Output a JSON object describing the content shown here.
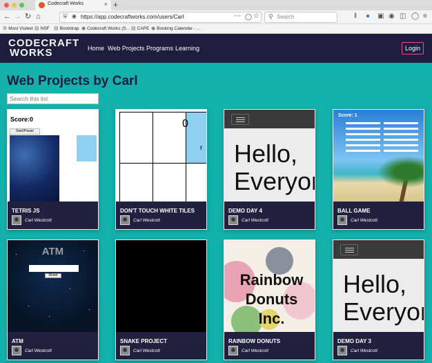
{
  "browser": {
    "tab_title": "Codecraft Works",
    "url": "https://app.codecraftworks.com/users/Carl",
    "search_placeholder": "Search",
    "bookmarks": [
      "Most Visited",
      "NSF",
      "Bootstrap",
      "Codecraft Works (S...",
      "CAPE",
      "Booking Calendar - ..."
    ]
  },
  "site": {
    "logo_top": "CODECRAFT",
    "logo_bottom": "WORKS",
    "menu": [
      "Home",
      "Web Projects",
      "Programs",
      "Learning"
    ],
    "login_label": "Login"
  },
  "page": {
    "title": "Web Projects by Carl",
    "search_placeholder": "Search this list"
  },
  "projects": [
    {
      "title": "TETRIS JS",
      "author": "Carl Westcott",
      "thumb": {
        "score": "Score:0",
        "button": "Start/Pause"
      }
    },
    {
      "title": "DON'T TOUCH WHITE TILES",
      "author": "Carl Westcott",
      "thumb": {
        "score": "0",
        "letter": "r"
      }
    },
    {
      "title": "DEMO DAY 4",
      "author": "Carl Westcott",
      "thumb": {
        "text_1": "Hello,",
        "text_2": "Everyon"
      }
    },
    {
      "title": "BALL GAME",
      "author": "Carl Westcott",
      "thumb": {
        "score": "Score: 1"
      }
    },
    {
      "title": "ATM",
      "author": "Carl Westcott",
      "thumb": {
        "heading": "ATM",
        "button": "Reset"
      }
    },
    {
      "title": "SNAKE PROJECT",
      "author": "Carl Westcott",
      "thumb": {}
    },
    {
      "title": "RAINBOW DONUTS",
      "author": "Carl Westcott",
      "thumb": {
        "text_1": "Rainbow",
        "text_2": "Donuts",
        "text_3": "Inc."
      }
    },
    {
      "title": "DEMO DAY 3",
      "author": "Carl Westcott",
      "thumb": {
        "text_1": "Hello,",
        "text_2": "Everyon"
      }
    }
  ],
  "colors": {
    "page_bg": "#14b1ac",
    "header_bg": "#1f1d3d",
    "card_footer": "#22203f",
    "login_border": "#e94b9b"
  }
}
